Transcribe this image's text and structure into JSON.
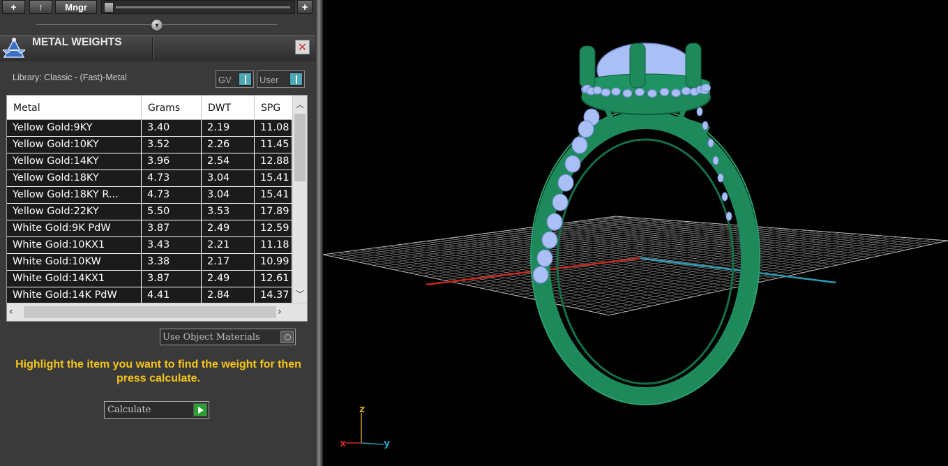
{
  "toolbar": {
    "add_label": "+",
    "up_label": "↑",
    "manager_label": "Mngr",
    "add2_label": "+"
  },
  "panel": {
    "title": "METAL WEIGHTS",
    "close_label": "✕",
    "library_label": "Library: Classic - (Fast)-Metal",
    "toggle_gv_label": "GV",
    "toggle_user_label": "User"
  },
  "table": {
    "columns": [
      "Metal",
      "Grams",
      "DWT",
      "SPG"
    ],
    "rows": [
      {
        "metal": "Yellow Gold:9KY",
        "grams": "3.40",
        "dwt": "2.19",
        "spg": "11.08"
      },
      {
        "metal": "Yellow Gold:10KY",
        "grams": "3.52",
        "dwt": "2.26",
        "spg": "11.45"
      },
      {
        "metal": "Yellow Gold:14KY",
        "grams": "3.96",
        "dwt": "2.54",
        "spg": "12.88"
      },
      {
        "metal": "Yellow Gold:18KY",
        "grams": "4.73",
        "dwt": "3.04",
        "spg": "15.41"
      },
      {
        "metal": "Yellow Gold:18KY R...",
        "grams": "4.73",
        "dwt": "3.04",
        "spg": "15.41"
      },
      {
        "metal": "Yellow Gold:22KY",
        "grams": "5.50",
        "dwt": "3.53",
        "spg": "17.89"
      },
      {
        "metal": "White Gold:9K PdW",
        "grams": "3.87",
        "dwt": "2.49",
        "spg": "12.59"
      },
      {
        "metal": "White Gold:10KX1",
        "grams": "3.43",
        "dwt": "2.21",
        "spg": "11.18"
      },
      {
        "metal": "White Gold:10KW",
        "grams": "3.38",
        "dwt": "2.17",
        "spg": "10.99"
      },
      {
        "metal": "White Gold:14KX1",
        "grams": "3.87",
        "dwt": "2.49",
        "spg": "12.61"
      },
      {
        "metal": "White Gold:14K PdW",
        "grams": "4.41",
        "dwt": "2.84",
        "spg": "14.37"
      }
    ]
  },
  "controls": {
    "use_object_materials_label": "Use Object Materials",
    "hint_text": "Highlight the item you want to find the weight for then press calculate.",
    "calculate_label": "Calculate"
  },
  "viewport": {
    "axis_x_label": "x",
    "axis_y_label": "y",
    "axis_z_label": "z",
    "colors": {
      "ring": "#1e8a5c",
      "stones": "#a9bff5",
      "grid": "#9a9a9a",
      "axis_x": "#c8281e",
      "axis_y": "#2a9fb8",
      "axis_z": "#d09a28"
    }
  }
}
